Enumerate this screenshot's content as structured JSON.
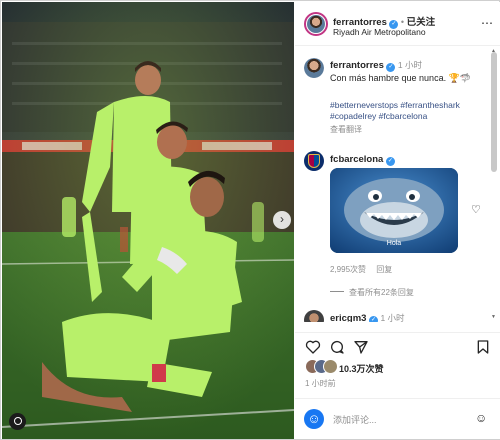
{
  "profile": {
    "username": "ferrantorres",
    "follow_status": "已关注",
    "separator": "•",
    "location": "Riyadh Air Metropolitano"
  },
  "caption": {
    "username": "ferrantorres",
    "time": "1 小时",
    "text": "Con más hambre que nunca.",
    "emojis": "🏆🦈",
    "hashtags": "#betterneverstops #ferrantheshark #copadelrey #fcbarcelona",
    "translate_label": "查看翻译"
  },
  "comment": {
    "username": "fcbarcelona",
    "gif_caption": "Hola",
    "likes": "2,995次赞",
    "reply_label": "回复",
    "view_replies_label": "查看所有22条回复"
  },
  "next_comment": {
    "username": "ericgm3",
    "time": "1 小时"
  },
  "actions": {
    "likes_count": "10.3万次赞",
    "time_ago": "1 小时前"
  },
  "composer": {
    "placeholder": "添加评论...",
    "emoji_glyph": "☺"
  },
  "colors": {
    "verified": "#3897f0",
    "link": "#385185",
    "jersey": "#b8f06a"
  }
}
